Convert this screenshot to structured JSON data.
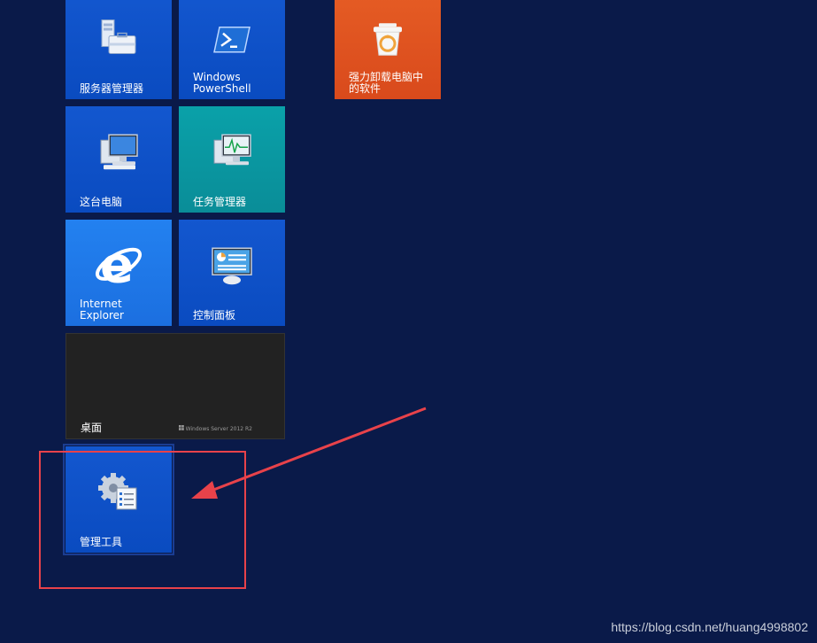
{
  "tiles": {
    "server_manager": {
      "label": "服务器管理器",
      "icon": "server-manager-icon"
    },
    "powershell": {
      "label": "Windows\nPowerShell",
      "icon": "powershell-icon"
    },
    "uninstaller": {
      "label": "强力卸载电脑中\n的软件",
      "icon": "recycle-bin-icon"
    },
    "this_pc": {
      "label": "这台电脑",
      "icon": "computer-icon"
    },
    "task_manager": {
      "label": "任务管理器",
      "icon": "task-manager-icon"
    },
    "internet_explorer": {
      "label": "Internet\nExplorer",
      "icon": "ie-icon"
    },
    "control_panel": {
      "label": "控制面板",
      "icon": "control-panel-icon"
    },
    "desktop": {
      "label": "桌面",
      "brand": "Windows Server 2012 R2"
    },
    "admin_tools": {
      "label": "管理工具",
      "icon": "admin-tools-icon"
    }
  },
  "watermark": "https://blog.csdn.net/huang4998802",
  "colors": {
    "background": "#0a1a49",
    "tile_blue": "#0a4bc0",
    "tile_teal": "#0a8d98",
    "tile_orange": "#d94a1c",
    "annotation_red": "#e8424a"
  }
}
